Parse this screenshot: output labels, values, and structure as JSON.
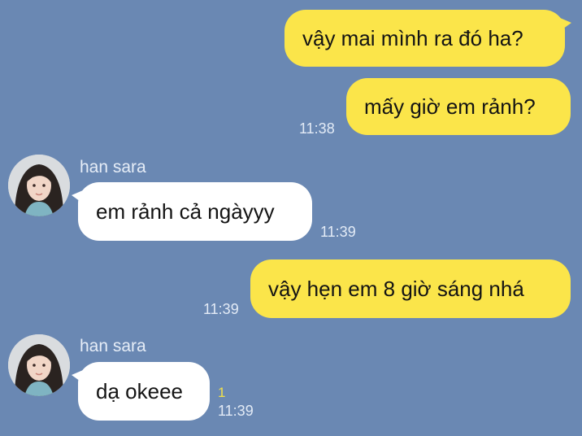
{
  "messages": [
    {
      "id": "m1",
      "direction": "out",
      "text": "vậy mai mình ra đó ha?"
    },
    {
      "id": "m2",
      "direction": "out",
      "text": "mấy giờ em rảnh?",
      "time": "11:38"
    },
    {
      "id": "m3",
      "direction": "in",
      "sender": "han sara",
      "text": "em rảnh cả ngàyyy",
      "time": "11:39"
    },
    {
      "id": "m4",
      "direction": "out",
      "text": "vậy hẹn em 8 giờ sáng nhá",
      "time": "11:39"
    },
    {
      "id": "m5",
      "direction": "in",
      "sender": "han sara",
      "text": "dạ okeee",
      "time": "11:39",
      "unread": "1"
    }
  ],
  "colors": {
    "background": "#6a88b3",
    "outgoing_bubble": "#fbe54a",
    "incoming_bubble": "#ffffff",
    "unread_count": "#f2e04a"
  }
}
